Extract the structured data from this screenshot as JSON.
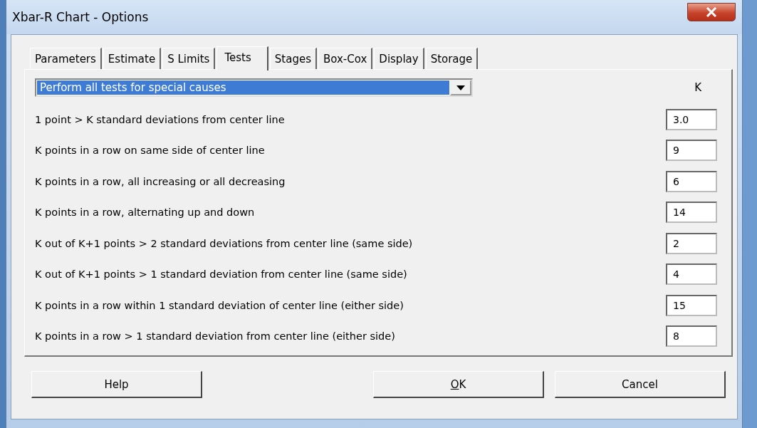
{
  "window": {
    "title": "Xbar-R Chart - Options"
  },
  "tabs": [
    {
      "label": "Parameters",
      "selected": false
    },
    {
      "label": "Estimate",
      "selected": false
    },
    {
      "label": "S Limits",
      "selected": false
    },
    {
      "label": "Tests",
      "selected": true
    },
    {
      "label": "Stages",
      "selected": false
    },
    {
      "label": "Box-Cox",
      "selected": false
    },
    {
      "label": "Display",
      "selected": false
    },
    {
      "label": "Storage",
      "selected": false
    }
  ],
  "test_mode": {
    "value": "Perform all tests for special causes"
  },
  "k_header": "K",
  "tests": [
    {
      "label": "1 point > K standard deviations from center line",
      "k": "3.0"
    },
    {
      "label": "K points in a row on same side of center line",
      "k": "9"
    },
    {
      "label": "K points in a row, all increasing or all decreasing",
      "k": "6"
    },
    {
      "label": "K points in a row, alternating up and down",
      "k": "14"
    },
    {
      "label": "K out of K+1 points > 2 standard deviations from center line (same side)",
      "k": "2"
    },
    {
      "label": "K out of K+1 points > 1 standard deviation from center line (same side)",
      "k": "4"
    },
    {
      "label": "K points in a row within 1 standard deviation of center line (either side)",
      "k": "15"
    },
    {
      "label": "K points in a row > 1 standard deviation from center line (either side)",
      "k": "8"
    }
  ],
  "buttons": [
    {
      "label": "Help",
      "mnemonic_underlined": false
    },
    {
      "label": "OK",
      "mnemonic_underlined": true
    },
    {
      "label": "Cancel",
      "mnemonic_underlined": false
    }
  ]
}
